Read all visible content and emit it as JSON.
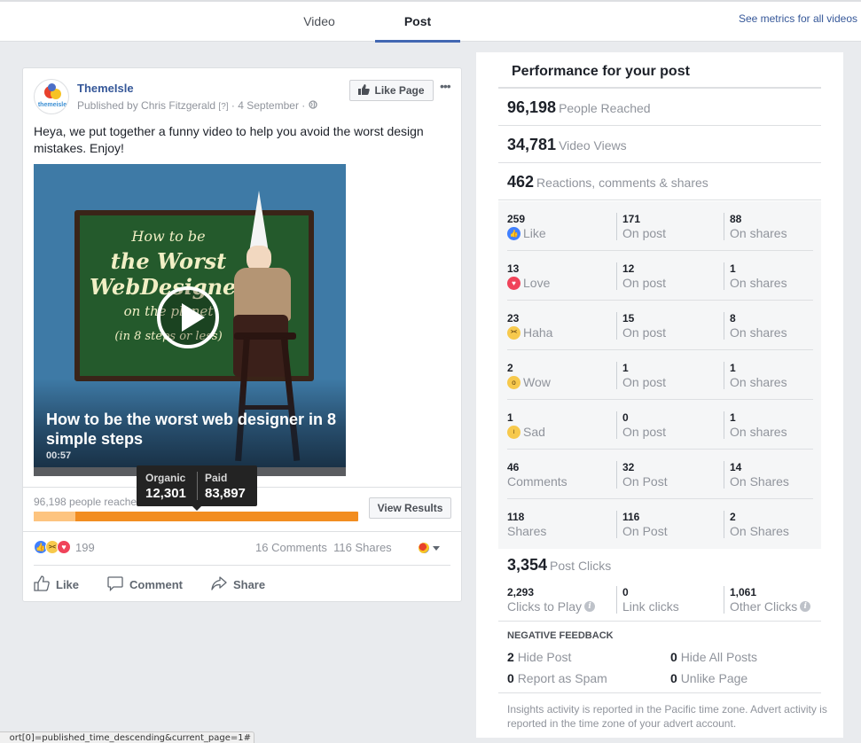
{
  "tabs": [
    {
      "label": "Video",
      "active": false
    },
    {
      "label": "Post",
      "active": true
    }
  ],
  "see_metrics_link": "See metrics for all videos",
  "post": {
    "page_name": "ThemeIsle",
    "avatar_brand": "themeisle",
    "published_by": "Published by Chris Fitzgerald",
    "help_marker": "[?]",
    "date": "4 September",
    "separator": "·",
    "privacy_icon": "globe-icon",
    "like_page_label": "Like Page",
    "more_label": "•••",
    "text": "Heya, we put together a funny video to help you avoid the worst design mistakes. Enjoy!",
    "video": {
      "board_lines": [
        "How to be",
        "the Worst",
        "WebDesigner",
        "on the planet",
        "(in 8 steps or less)"
      ],
      "title": "How to be the worst web designer in 8 simple steps",
      "duration": "00:57"
    },
    "reach": {
      "text": "96,198 people reached",
      "organic_label": "Organic",
      "organic_value": "12,301",
      "paid_label": "Paid",
      "paid_value": "83,897",
      "organic_fraction": 0.128,
      "view_results_label": "View Results"
    },
    "reactions_count": "199",
    "comments_label": "16 Comments",
    "shares_label": "116 Shares",
    "actions": [
      {
        "label": "Like",
        "icon": "thumbs-up-outline-icon"
      },
      {
        "label": "Comment",
        "icon": "comment-icon"
      },
      {
        "label": "Share",
        "icon": "share-arrow-icon"
      }
    ]
  },
  "performance": {
    "title": "Performance for your post",
    "headline_stats": [
      {
        "value": "96,198",
        "label": "People Reached"
      },
      {
        "value": "34,781",
        "label": "Video Views"
      },
      {
        "value": "462",
        "label": "Reactions, comments & shares"
      }
    ],
    "breakdown": [
      {
        "total": "259",
        "label": "Like",
        "icon": "like",
        "post": "171",
        "post_label": "On post",
        "shares": "88",
        "shares_label": "On shares"
      },
      {
        "total": "13",
        "label": "Love",
        "icon": "love",
        "post": "12",
        "post_label": "On post",
        "shares": "1",
        "shares_label": "On shares"
      },
      {
        "total": "23",
        "label": "Haha",
        "icon": "haha",
        "post": "15",
        "post_label": "On post",
        "shares": "8",
        "shares_label": "On shares"
      },
      {
        "total": "2",
        "label": "Wow",
        "icon": "wow",
        "post": "1",
        "post_label": "On post",
        "shares": "1",
        "shares_label": "On shares"
      },
      {
        "total": "1",
        "label": "Sad",
        "icon": "sad",
        "post": "0",
        "post_label": "On post",
        "shares": "1",
        "shares_label": "On shares"
      },
      {
        "total": "46",
        "label": "Comments",
        "icon": "",
        "post": "32",
        "post_label": "On Post",
        "shares": "14",
        "shares_label": "On Shares"
      },
      {
        "total": "118",
        "label": "Shares",
        "icon": "",
        "post": "116",
        "post_label": "On Post",
        "shares": "2",
        "shares_label": "On Shares"
      }
    ],
    "post_clicks": {
      "value": "3,354",
      "label": "Post Clicks",
      "items": [
        {
          "value": "2,293",
          "label": "Clicks to Play",
          "info": true
        },
        {
          "value": "0",
          "label": "Link clicks",
          "info": false
        },
        {
          "value": "1,061",
          "label": "Other Clicks",
          "info": true
        }
      ]
    },
    "negative_feedback": {
      "title": "NEGATIVE FEEDBACK",
      "items": [
        {
          "value": "2",
          "label": "Hide Post"
        },
        {
          "value": "0",
          "label": "Hide All Posts"
        },
        {
          "value": "0",
          "label": "Report as Spam"
        },
        {
          "value": "0",
          "label": "Unlike Page"
        }
      ]
    },
    "footnote": "Insights activity is reported in the Pacific time zone. Advert activity is reported in the time zone of your advert account."
  },
  "status_bar": "ort[0]=published_time_descending&current_page=1#"
}
